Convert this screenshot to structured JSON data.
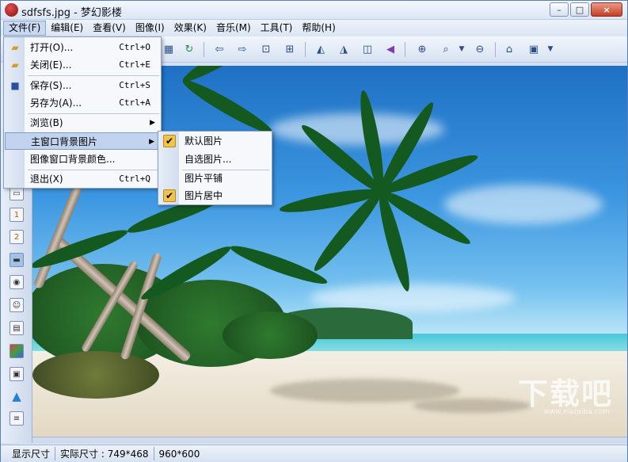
{
  "window": {
    "title": "sdfsfs.jpg - 梦幻影楼",
    "minimize_glyph": "–",
    "maximize_glyph": "□",
    "close_glyph": "×"
  },
  "menubar": [
    {
      "label": "文件(F)",
      "open": true
    },
    {
      "label": "编辑(E)"
    },
    {
      "label": "查看(V)"
    },
    {
      "label": "图像(I)"
    },
    {
      "label": "效果(K)"
    },
    {
      "label": "音乐(M)"
    },
    {
      "label": "工具(T)"
    },
    {
      "label": "帮助(H)"
    }
  ],
  "file_menu": {
    "items": [
      {
        "label": "打开(O)...",
        "shortcut": "Ctrl+O",
        "icon": "folder-open-icon"
      },
      {
        "label": "关闭(E)...",
        "shortcut": "Ctrl+E",
        "icon": "folder-close-icon"
      },
      {
        "label": "保存(S)...",
        "shortcut": "Ctrl+S",
        "icon": "floppy-disk-icon"
      },
      {
        "label": "另存为(A)...",
        "shortcut": "Ctrl+A"
      },
      {
        "label": "浏览(B)",
        "submenu": true
      },
      {
        "label": "主窗口背景图片",
        "submenu": true,
        "highlighted": true
      },
      {
        "label": "图像窗口背景颜色..."
      },
      {
        "label": "退出(X)",
        "shortcut": "Ctrl+Q"
      }
    ]
  },
  "background_submenu": {
    "items": [
      {
        "label": "默认图片",
        "checked": true
      },
      {
        "label": "自选图片...",
        "checked": false
      },
      {
        "label": "图片平铺",
        "checked": false
      },
      {
        "label": "图片居中",
        "checked": true
      }
    ]
  },
  "status": {
    "display_size_label": "显示尺寸",
    "actual_size_label": "实际尺寸",
    "actual_size_value": "749*468",
    "screen_size": "960*600"
  },
  "watermark": {
    "text": "下载吧",
    "url": "www.xiazaiba.com"
  },
  "colors": {
    "accent": "#c1d3ef",
    "check": "#f0c44a",
    "frame": "#5a7fb8"
  }
}
